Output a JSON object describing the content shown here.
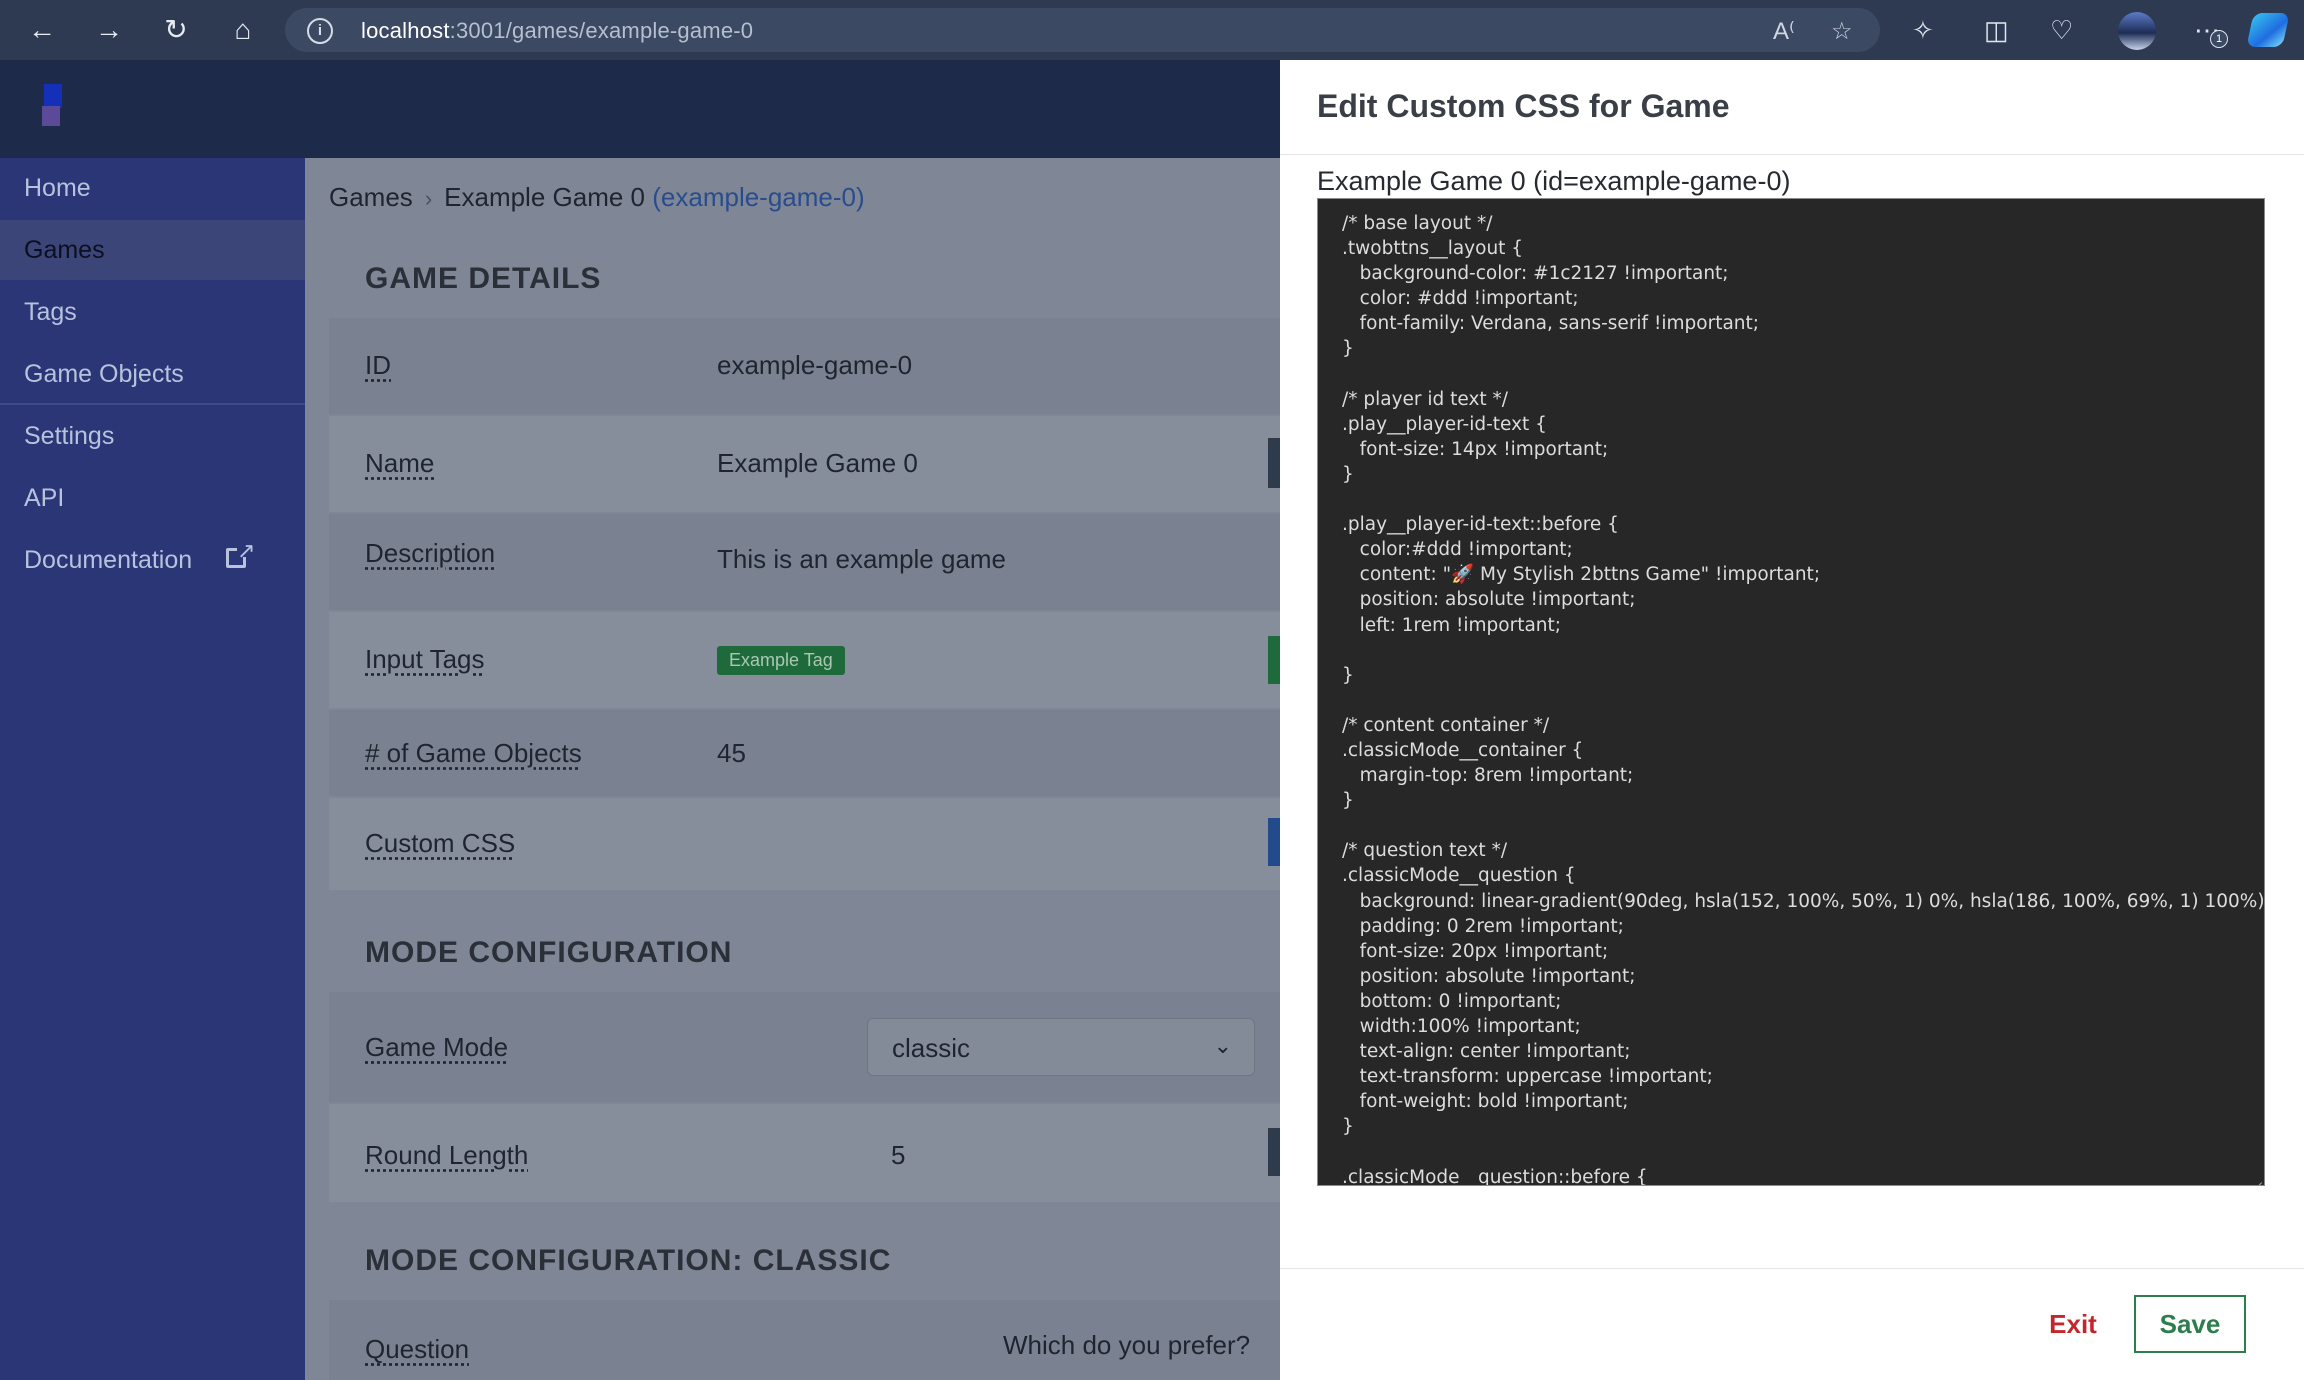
{
  "browser": {
    "url_host": "localhost",
    "url_path": ":3001/games/example-game-0",
    "notification_count": "1"
  },
  "sidebar": {
    "items": [
      {
        "label": "Home"
      },
      {
        "label": "Games"
      },
      {
        "label": "Tags"
      },
      {
        "label": "Game Objects"
      },
      {
        "label": "Settings"
      },
      {
        "label": "API"
      },
      {
        "label": "Documentation"
      }
    ]
  },
  "breadcrumb": {
    "root": "Games",
    "current": "Example Game 0",
    "slug": "(example-game-0)"
  },
  "game_details": {
    "title": "GAME DETAILS",
    "rows": [
      {
        "label": "ID",
        "value": "example-game-0"
      },
      {
        "label": "Name",
        "value": "Example Game 0"
      },
      {
        "label": "Description",
        "value": "This is an example game"
      },
      {
        "label": "Input Tags",
        "value": "Example Tag"
      },
      {
        "label": "# of Game Objects",
        "value": "45"
      },
      {
        "label": "Custom CSS",
        "value": ""
      }
    ]
  },
  "mode_config": {
    "title": "MODE CONFIGURATION",
    "game_mode_label": "Game Mode",
    "game_mode_value": "classic",
    "round_length_label": "Round Length",
    "round_length_value": "5"
  },
  "classic_config": {
    "title": "MODE CONFIGURATION: CLASSIC",
    "question_label": "Question",
    "question_value": "Which do you prefer?"
  },
  "modal": {
    "title": "Edit Custom CSS for Game",
    "subtitle": "Example Game 0 (id=example-game-0)",
    "css": "/* base layout */\n.twobttns__layout {\n   background-color: #1c2127 !important;\n   color: #ddd !important;\n   font-family: Verdana, sans-serif !important;\n}\n\n/* player id text */\n.play__player-id-text {\n   font-size: 14px !important;\n}\n\n.play__player-id-text::before {\n   color:#ddd !important;\n   content: \"🚀 My Stylish 2bttns Game\" !important;\n   position: absolute !important;\n   left: 1rem !important;\n\n}\n\n/* content container */\n.classicMode__container {\n   margin-top: 8rem !important;\n}\n\n/* question text */\n.classicMode__question {\n   background: linear-gradient(90deg, hsla(152, 100%, 50%, 1) 0%, hsla(186, 100%, 69%, 1) 100%);\n   padding: 0 2rem !important;\n   font-size: 20px !important;\n   position: absolute !important;\n   bottom: 0 !important;\n   width:100% !important;\n   text-align: center !important;\n   text-transform: uppercase !important;\n   font-weight: bold !important;\n}\n\n.classicMode__question::before {",
    "exit_label": "Exit",
    "save_label": "Save"
  }
}
